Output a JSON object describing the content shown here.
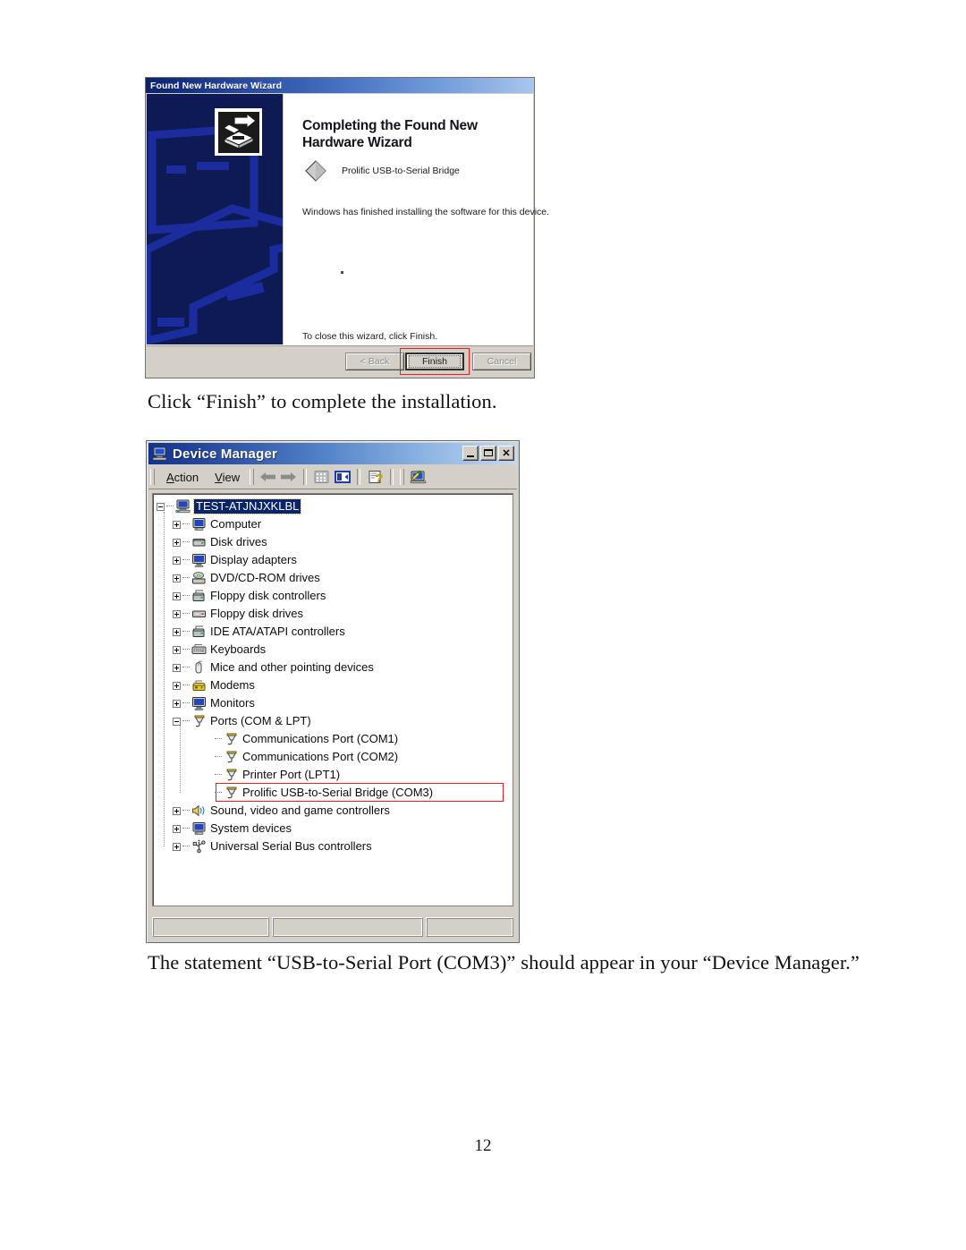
{
  "document": {
    "caption_finish": "Click “Finish” to complete the installation.",
    "caption_devmgr": "The statement “USB-to-Serial Port (COM3)” should appear in your “Device Manager.”",
    "page_number": "12"
  },
  "wizard": {
    "title": "Found New Hardware Wizard",
    "heading": "Completing the Found New Hardware Wizard",
    "device_name": "Prolific USB-to-Serial Bridge",
    "description": "Windows has finished installing the software for this device.",
    "close_note": "To close this wizard, click Finish.",
    "buttons": {
      "back": "< Back",
      "finish": "Finish",
      "cancel": "Cancel"
    },
    "highlight_color": "#ee1c22",
    "titlebar_color": "#0a216e",
    "banner_color": "#0d1a54"
  },
  "device_manager": {
    "title": "Device Manager",
    "window_buttons": {
      "minimize": "minimize",
      "maximize": "maximize",
      "close": "✕"
    },
    "menu": [
      {
        "label": "Action",
        "accel": "A"
      },
      {
        "label": "View",
        "accel": "V"
      }
    ],
    "toolbar_icons": [
      "back-arrow-icon",
      "forward-arrow-icon",
      "properties-icon",
      "show-hide-console-tree-icon",
      "help-icon",
      "scan-for-hardware-changes-icon"
    ],
    "tree": [
      {
        "label": "TEST-ATJNJXKLBL",
        "level": 0,
        "expander": "minus",
        "icon": "computer-node-icon",
        "selected": true
      },
      {
        "label": "Computer",
        "level": 1,
        "expander": "plus",
        "icon": "computer-icon",
        "selected": false
      },
      {
        "label": "Disk drives",
        "level": 1,
        "expander": "plus",
        "icon": "disk-drive-icon",
        "selected": false
      },
      {
        "label": "Display adapters",
        "level": 1,
        "expander": "plus",
        "icon": "display-adapter-icon",
        "selected": false
      },
      {
        "label": "DVD/CD-ROM drives",
        "level": 1,
        "expander": "plus",
        "icon": "dvd-drive-icon",
        "selected": false
      },
      {
        "label": "Floppy disk controllers",
        "level": 1,
        "expander": "plus",
        "icon": "floppy-controller-icon",
        "selected": false
      },
      {
        "label": "Floppy disk drives",
        "level": 1,
        "expander": "plus",
        "icon": "floppy-drive-icon",
        "selected": false
      },
      {
        "label": "IDE ATA/ATAPI controllers",
        "level": 1,
        "expander": "plus",
        "icon": "ide-controller-icon",
        "selected": false
      },
      {
        "label": "Keyboards",
        "level": 1,
        "expander": "plus",
        "icon": "keyboard-icon",
        "selected": false
      },
      {
        "label": "Mice and other pointing devices",
        "level": 1,
        "expander": "plus",
        "icon": "mouse-icon",
        "selected": false
      },
      {
        "label": "Modems",
        "level": 1,
        "expander": "plus",
        "icon": "modem-icon",
        "selected": false
      },
      {
        "label": "Monitors",
        "level": 1,
        "expander": "plus",
        "icon": "monitor-icon",
        "selected": false
      },
      {
        "label": "Ports (COM & LPT)",
        "level": 1,
        "expander": "minus",
        "icon": "port-icon",
        "selected": false
      },
      {
        "label": "Communications Port (COM1)",
        "level": 2,
        "expander": "none",
        "icon": "port-icon",
        "selected": false
      },
      {
        "label": "Communications Port (COM2)",
        "level": 2,
        "expander": "none",
        "icon": "port-icon",
        "selected": false
      },
      {
        "label": "Printer Port (LPT1)",
        "level": 2,
        "expander": "none",
        "icon": "port-icon",
        "selected": false
      },
      {
        "label": "Prolific USB-to-Serial Bridge (COM3)",
        "level": 2,
        "expander": "none",
        "icon": "port-icon",
        "selected": false,
        "highlighted": true
      },
      {
        "label": "Sound, video and game controllers",
        "level": 1,
        "expander": "plus",
        "icon": "sound-icon",
        "selected": false
      },
      {
        "label": "System devices",
        "level": 1,
        "expander": "plus",
        "icon": "system-device-icon",
        "selected": false
      },
      {
        "label": "Universal Serial Bus controllers",
        "level": 1,
        "expander": "plus",
        "icon": "usb-controller-icon",
        "selected": false
      }
    ],
    "status_panes": [
      "",
      "",
      ""
    ],
    "highlight_color": "#ee1c22"
  }
}
